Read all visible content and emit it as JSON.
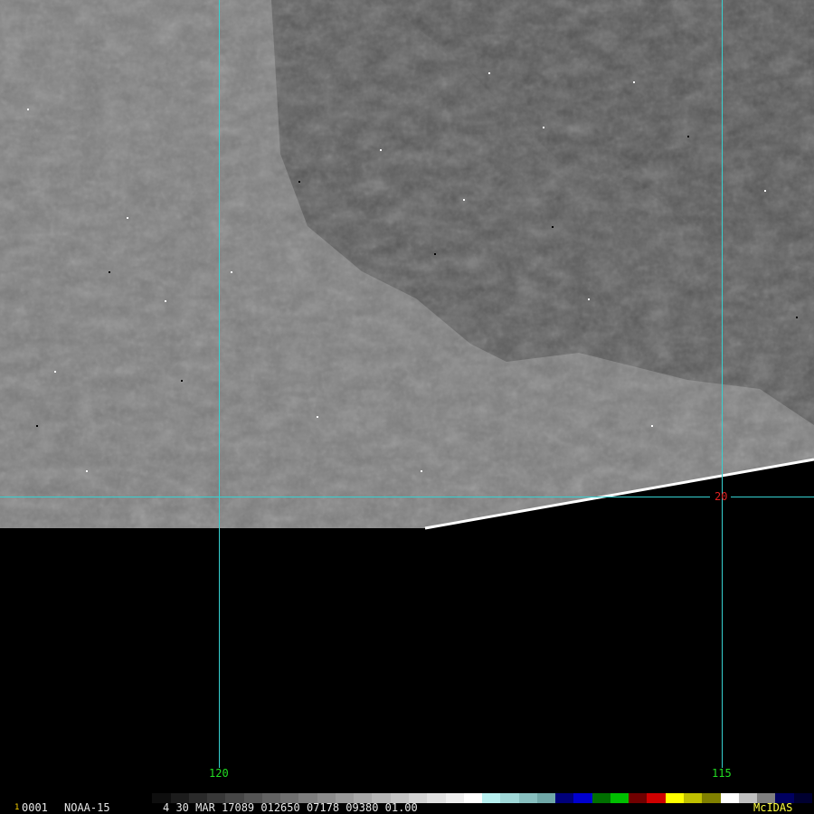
{
  "map": {
    "grid_labels": {
      "lon_120": "120",
      "lon_115": "115",
      "lat_20": "20"
    },
    "colors": {
      "grid_line": "#36d0d0",
      "lon_label": "#22dd22",
      "lat_label": "#e02020",
      "coastline": "#ffffff",
      "land": "#808080",
      "water": "#4e4e4e",
      "no_data": "#000000"
    }
  },
  "status_bar": {
    "frame_num": "1",
    "frame_id": "0001",
    "satellite": "NOAA-15",
    "image_info": "4 30 MAR 17089 012650 07178 09380 01.00",
    "software": "McIDAS",
    "colors": {
      "frame_num": "#ffd700",
      "software": "#ffff40",
      "text": "#e8e8e8"
    },
    "enhancement_colors": [
      "#000000",
      "#0e0e0e",
      "#1c1c1c",
      "#2a2a2a",
      "#383838",
      "#464646",
      "#545454",
      "#626262",
      "#707070",
      "#7e7e7e",
      "#8c8c8c",
      "#9a9a9a",
      "#a8a8a8",
      "#b6b6b6",
      "#c4c4c4",
      "#d2d2d2",
      "#e0e0e0",
      "#eeeeee",
      "#ffffff",
      "#b8f0f0",
      "#a0d8d8",
      "#88c0c0",
      "#70a8a8",
      "#00007a",
      "#0000d0",
      "#007000",
      "#00c000",
      "#700000",
      "#d00000",
      "#ffff00",
      "#c0c000",
      "#808000",
      "#ffffff",
      "#c0c0c0",
      "#808080",
      "#000060",
      "#000030"
    ]
  }
}
